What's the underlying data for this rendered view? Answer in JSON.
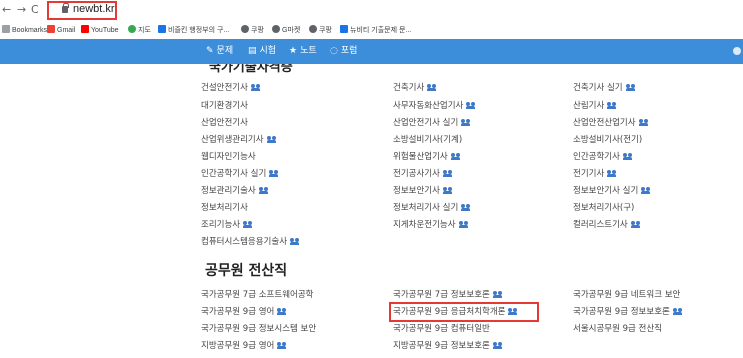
{
  "browser": {
    "back": "←",
    "forward": "→",
    "reload": "C",
    "url": "newbt.kr"
  },
  "bookmarks": [
    {
      "label": "Bookmarks",
      "color": "#5f6368"
    },
    {
      "label": "Gmail",
      "color": "#ea4335"
    },
    {
      "label": "YouTube",
      "color": "#ff0000"
    },
    {
      "label": "지도",
      "color": "#34a853"
    },
    {
      "label": "비즐킨 행정부의 구...",
      "color": "#1a73e8"
    },
    {
      "label": "쿠팡",
      "color": "#444444"
    },
    {
      "label": "G마켓",
      "color": "#444444"
    },
    {
      "label": "쿠팡",
      "color": "#444444"
    },
    {
      "label": "뉴비티 기출문제 문...",
      "color": "#1a73e8"
    }
  ],
  "nav": {
    "items": [
      {
        "icon": "✎",
        "label": "문제"
      },
      {
        "icon": "▤",
        "label": "시험"
      },
      {
        "icon": "★",
        "label": "노트"
      },
      {
        "icon": "◌",
        "label": "포럼"
      }
    ]
  },
  "partial_heading": "국가기술자격증",
  "cert_columns": [
    [
      {
        "label": "건설안전기사",
        "people": true
      },
      {
        "label": "대기환경기사",
        "people": false
      },
      {
        "label": "산업안전기사",
        "people": false
      },
      {
        "label": "산업위생관리기사",
        "people": true
      },
      {
        "label": "웹디자인기능사",
        "people": false
      },
      {
        "label": "인간공학기사 실기",
        "people": true
      },
      {
        "label": "정보관리기술사",
        "people": true
      },
      {
        "label": "정보처리기사",
        "people": false
      },
      {
        "label": "조리기능사",
        "people": true
      },
      {
        "label": "컴퓨터시스템응용기술사",
        "people": true
      }
    ],
    [
      {
        "label": "건축기사",
        "people": true
      },
      {
        "label": "사무자동화산업기사",
        "people": true
      },
      {
        "label": "산업안전기사 실기",
        "people": true
      },
      {
        "label": "소방설비기사(기계)",
        "people": false
      },
      {
        "label": "위험물산업기사",
        "people": true
      },
      {
        "label": "전기공사기사",
        "people": true
      },
      {
        "label": "정보보안기사",
        "people": true
      },
      {
        "label": "정보처리기사 실기",
        "people": true
      },
      {
        "label": "지게차운전기능사",
        "people": true
      }
    ],
    [
      {
        "label": "건축기사 실기",
        "people": true
      },
      {
        "label": "산림기사",
        "people": true
      },
      {
        "label": "산업안전산업기사",
        "people": true
      },
      {
        "label": "소방설비기사(전기)",
        "people": false
      },
      {
        "label": "인간공학기사",
        "people": true
      },
      {
        "label": "전기기사",
        "people": true
      },
      {
        "label": "정보보안기사 실기",
        "people": true
      },
      {
        "label": "정보처리기사(구)",
        "people": false
      },
      {
        "label": "컬러리스트기사",
        "people": true
      }
    ]
  ],
  "section_title": "공무원 전산직",
  "gov_columns": [
    [
      {
        "label": "국가공무원 7급 소프트웨어공학",
        "people": false
      },
      {
        "label": "국가공무원 9급 영어",
        "people": true
      },
      {
        "label": "국가공무원 9급 정보시스템 보안",
        "people": false
      },
      {
        "label": "지방공무원 9급 영어",
        "people": true
      }
    ],
    [
      {
        "label": "국가공무원 7급 정보보호론",
        "people": true
      },
      {
        "label": "국가공무원 9급 응급처치학개론",
        "people": true
      },
      {
        "label": "국가공무원 9급 컴퓨터일반",
        "people": false
      },
      {
        "label": "지방공무원 9급 정보보호론",
        "people": true
      }
    ],
    [
      {
        "label": "국가공무원 9급 네트워크 보안",
        "people": false
      },
      {
        "label": "국가공무원 9급 정보보호론",
        "people": true
      },
      {
        "label": "서울시공무원 9급 전산직",
        "people": false
      }
    ]
  ]
}
